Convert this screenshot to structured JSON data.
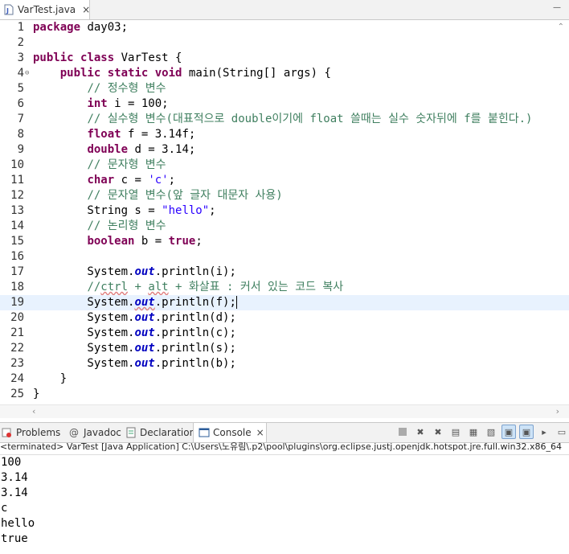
{
  "editor_tab": {
    "title": "VarTest.java",
    "close": "×"
  },
  "editor_lines": [
    {
      "n": "1",
      "html": "<span class='kw'>package</span> day03;"
    },
    {
      "n": "2",
      "html": ""
    },
    {
      "n": "3",
      "html": "<span class='kw'>public</span> <span class='kw'>class</span> VarTest {"
    },
    {
      "n": "4",
      "html": "    <span class='kw'>public</span> <span class='kw'>static</span> <span class='kw'>void</span> main(String[] args) {",
      "fold": true
    },
    {
      "n": "5",
      "html": "        <span class='cm'>// 정수형 변수</span>"
    },
    {
      "n": "6",
      "html": "        <span class='kw'>int</span> i = 100;"
    },
    {
      "n": "7",
      "html": "        <span class='cm'>// 실수형 변수(대표적으로 double이기에 float 쓸때는 실수 숫자뒤에 f를 붙힌다.)</span>"
    },
    {
      "n": "8",
      "html": "        <span class='kw'>float</span> f = 3.14f;"
    },
    {
      "n": "9",
      "html": "        <span class='kw'>double</span> d = 3.14;"
    },
    {
      "n": "10",
      "html": "        <span class='cm'>// 문자형 변수</span>"
    },
    {
      "n": "11",
      "html": "        <span class='kw'>char</span> c = <span class='str'>'c'</span>;"
    },
    {
      "n": "12",
      "html": "        <span class='cm'>// 문자열 변수(앞 글자 대문자 사용)</span>"
    },
    {
      "n": "13",
      "html": "        String s = <span class='str'>\"hello\"</span>;"
    },
    {
      "n": "14",
      "html": "        <span class='cm'>// 논리형 변수</span>"
    },
    {
      "n": "15",
      "html": "        <span class='kw'>boolean</span> b = <span class='kw'>true</span>;"
    },
    {
      "n": "16",
      "html": ""
    },
    {
      "n": "17",
      "html": "        System.<span class='fld'>out</span>.println(i);"
    },
    {
      "n": "18",
      "html": "        <span class='cm'>//<span class='squig'>ctrl</span> + <span class='squig'>alt</span> + 화살표 : 커서 있는 코드 복사</span>"
    },
    {
      "n": "19",
      "html": "        System.<span class='fld squig'>out</span>.println(f);<span style='border-left:1px solid #000'></span>",
      "current": true
    },
    {
      "n": "20",
      "html": "        System.<span class='fld'>out</span>.println(d);"
    },
    {
      "n": "21",
      "html": "        System.<span class='fld'>out</span>.println(c);"
    },
    {
      "n": "22",
      "html": "        System.<span class='fld'>out</span>.println(s);"
    },
    {
      "n": "23",
      "html": "        System.<span class='fld'>out</span>.println(b);"
    },
    {
      "n": "24",
      "html": "    }"
    },
    {
      "n": "25",
      "html": "}"
    }
  ],
  "panel_tabs": {
    "problems": "Problems",
    "javadoc": "Javadoc",
    "declaration": "Declaration",
    "console": "Console",
    "console_close": "×"
  },
  "console_header": "<terminated> VarTest [Java Application] C:\\Users\\노유림\\.p2\\pool\\plugins\\org.eclipse.justj.openjdk.hotspot.jre.full.win32.x86_64",
  "console_output": [
    "100",
    "3.14",
    "3.14",
    "c",
    "hello",
    "true"
  ],
  "colors": {
    "keyword": "#7f0055",
    "comment": "#3f7f5f",
    "string": "#2a00ff",
    "field": "#0000c0",
    "current_line": "#e8f2fe"
  }
}
